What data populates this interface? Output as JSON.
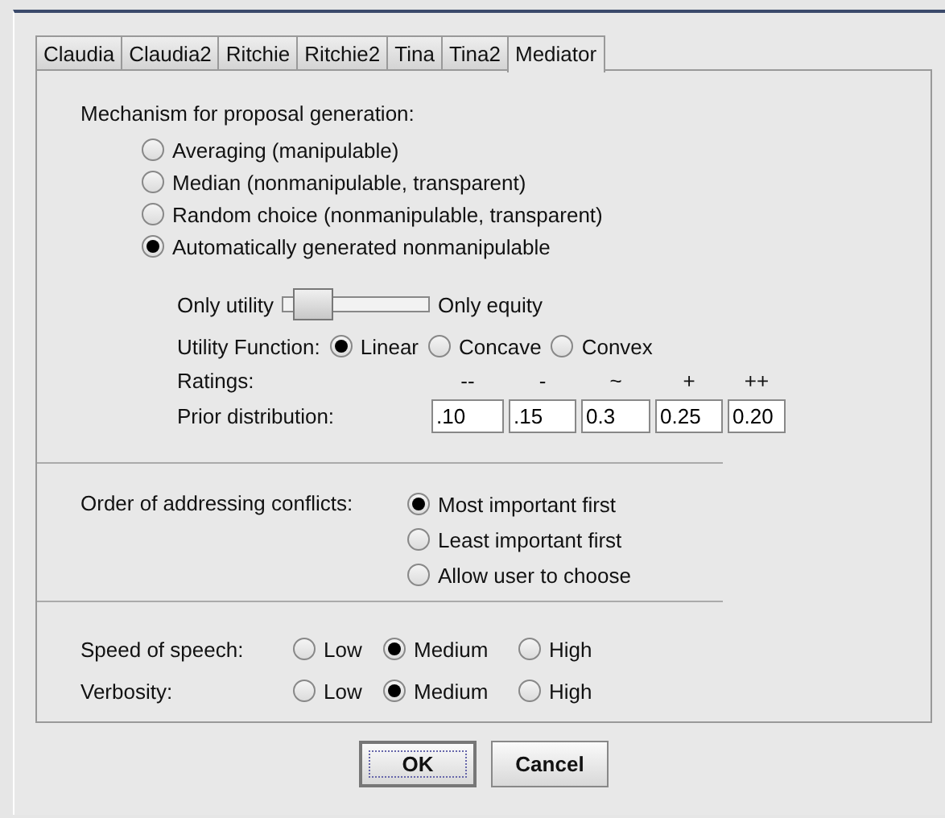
{
  "tabs": [
    {
      "label": "Claudia",
      "selected": false
    },
    {
      "label": "Claudia2",
      "selected": false
    },
    {
      "label": "Ritchie",
      "selected": false
    },
    {
      "label": "Ritchie2",
      "selected": false
    },
    {
      "label": "Tina",
      "selected": false
    },
    {
      "label": "Tina2",
      "selected": false
    },
    {
      "label": "Mediator",
      "selected": true
    }
  ],
  "mechanism": {
    "label": "Mechanism for proposal generation:",
    "options": [
      {
        "label": "Averaging (manipulable)",
        "selected": false
      },
      {
        "label": "Median (nonmanipulable, transparent)",
        "selected": false
      },
      {
        "label": "Random choice (nonmanipulable, transparent)",
        "selected": false
      },
      {
        "label": "Automatically generated nonmanipulable",
        "selected": true
      }
    ]
  },
  "slider": {
    "left_label": "Only utility",
    "right_label": "Only equity",
    "level": 0.1
  },
  "utility_function": {
    "label": "Utility Function:",
    "options": [
      {
        "label": "Linear",
        "selected": true
      },
      {
        "label": "Concave",
        "selected": false
      },
      {
        "label": "Convex",
        "selected": false
      }
    ]
  },
  "ratings": {
    "label": "Ratings:",
    "columns": [
      "--",
      "-",
      "~",
      "+",
      "++"
    ]
  },
  "prior_distribution": {
    "label": "Prior distribution:",
    "values": [
      ".10",
      ".15",
      "0.3",
      "0.25",
      "0.20"
    ]
  },
  "order": {
    "label": "Order of addressing conflicts:",
    "options": [
      {
        "label": "Most important first",
        "selected": true
      },
      {
        "label": "Least important first",
        "selected": false
      },
      {
        "label": "Allow user to choose",
        "selected": false
      }
    ]
  },
  "speed": {
    "label": "Speed of speech:",
    "options": [
      {
        "label": "Low",
        "selected": false
      },
      {
        "label": "Medium",
        "selected": true
      },
      {
        "label": "High",
        "selected": false
      }
    ]
  },
  "verbosity": {
    "label": "Verbosity:",
    "options": [
      {
        "label": "Low",
        "selected": false
      },
      {
        "label": "Medium",
        "selected": true
      },
      {
        "label": "High",
        "selected": false
      }
    ]
  },
  "buttons": [
    {
      "label": "OK",
      "focused": true
    },
    {
      "label": "Cancel",
      "focused": false
    }
  ]
}
